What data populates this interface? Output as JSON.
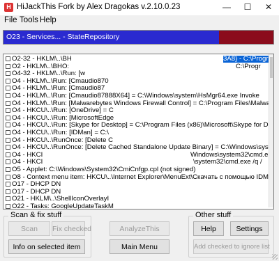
{
  "window": {
    "title": "HiJackThis Fork by Alex Dragokas v.2.10.0.23",
    "icon": "hijackthis-app-icon",
    "controls": {
      "minimize": "—",
      "maximize": "☐",
      "close": "✕"
    }
  },
  "menu": [
    "File",
    "Tools",
    "Help"
  ],
  "banner": {
    "text": "O23 - Services... - StateRepository",
    "colors": {
      "blue": "#2a2ad0",
      "red": "#8b0c1c"
    }
  },
  "list": {
    "selected_fragment": "3A8} - C:\\Progr",
    "rows": [
      "O2-32 - HKLM\\..\\BH",
      "O2 - HKLM\\..\\BHO:",
      "O4-32 - HKLM\\..\\Run: [w",
      "O4 - HKLM\\..\\Run: [Cmaudio870",
      "O4 - HKLM\\..\\Run: [Cmaudio87",
      "O4 - HKLM\\..\\Run: [Cmaudio87888X64] = C:\\Windows\\system\\HsMgr64.exe Invoke",
      "O4 - HKLM\\..\\Run: [Malwarebytes Windows Firewall Control] = C:\\Program Files\\Malwarebytes",
      "O4 - HKCU\\..\\Run: [OneDrive] = C",
      "O4 - HKCU\\..\\Run: [MicrosoftEdge",
      "O4 - HKCU\\..\\Run: [Skype for Desktop] = C:\\Program Files (x86)\\Microsoft\\Skype for Desktop",
      "O4 - HKCU\\..\\Run: [IDMan] = C:\\",
      "O4 - HKCU\\..\\RunOnce: [Delete C",
      "O4 - HKCU\\..\\RunOnce: [Delete Cached Standalone Update Binary] = C:\\Windows\\system32\\",
      "O4 - HKCI",
      "O4 - HKCI",
      "O5 - Applet: C:\\Windows\\System32\\CmiCnfgp.cpl (not signed)",
      "O8 - Context menu item: HKCU\\..\\Internet Explorer\\MenuExt\\Скачать с помощью IDM: [defa",
      "O17 - DHCP DN",
      "O17 - DHCP DN",
      "O21 - HKLM\\..\\ShellIconOverlayI",
      "O22 - Tasks: GoogleUpdateTaskM"
    ],
    "fragments": [
      {
        "row": 1,
        "text": "C:\\Progr"
      },
      {
        "row": 13,
        "text": "Windows\\system32\\cmd.e"
      },
      {
        "row": 14,
        "text": "\\system32\\cmd.exe /q /"
      }
    ]
  },
  "groups": {
    "scan_fix": {
      "title": "Scan & fix stuff",
      "scan": "Scan",
      "fix_checked": "Fix checked",
      "info": "Info on selected item"
    },
    "analyze": "AnalyzeThis",
    "main_menu": "Main Menu",
    "other": {
      "title": "Other stuff",
      "help": "Help",
      "settings": "Settings",
      "ignore": "Add checked to ignore list"
    }
  }
}
